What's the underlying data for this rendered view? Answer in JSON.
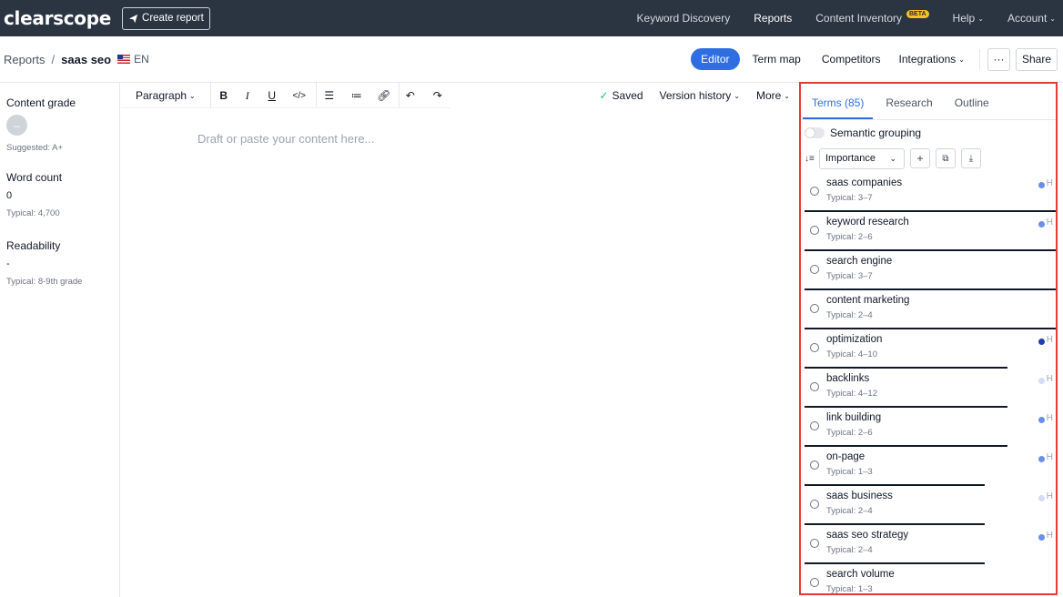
{
  "topnav": {
    "logo": "clearscope",
    "create_report": "Create report",
    "items": [
      {
        "label": "Keyword Discovery"
      },
      {
        "label": "Reports"
      },
      {
        "label": "Content Inventory",
        "badge": "BETA"
      },
      {
        "label": "Help"
      },
      {
        "label": "Account"
      }
    ]
  },
  "breadcrumb": {
    "root": "Reports",
    "separator": "/",
    "current": "saas seo",
    "lang": "EN"
  },
  "subnav": {
    "editor": "Editor",
    "term_map": "Term map",
    "competitors": "Competitors",
    "integrations": "Integrations",
    "more": "···",
    "share": "Share"
  },
  "stats": {
    "content_grade": {
      "label": "Content grade",
      "value": "–",
      "sub": "Suggested: A+"
    },
    "word_count": {
      "label": "Word count",
      "value": "0",
      "sub": "Typical: 4,700"
    },
    "readability": {
      "label": "Readability",
      "value": "-",
      "sub": "Typical: 8-9th grade"
    }
  },
  "toolbar": {
    "paragraph": "Paragraph",
    "saved": "Saved",
    "version_history": "Version history",
    "more": "More"
  },
  "editor": {
    "placeholder": "Draft or paste your content here..."
  },
  "panel": {
    "tabs": [
      "Terms (85)",
      "Research",
      "Outline"
    ],
    "semantic_grouping": "Semantic grouping",
    "sort_select": "Importance",
    "terms": [
      {
        "name": "saas companies",
        "typical": "Typical: 3–7",
        "h": "H",
        "dot_color": "#6b8fe8",
        "progress": 1.0
      },
      {
        "name": "keyword research",
        "typical": "Typical: 2–6",
        "h": "H",
        "dot_color": "#6b8fe8",
        "progress": 1.0
      },
      {
        "name": "search engine",
        "typical": "Typical: 3–7",
        "h": "",
        "dot_color": "",
        "progress": 1.0
      },
      {
        "name": "content marketing",
        "typical": "Typical: 2–4",
        "h": "",
        "dot_color": "",
        "progress": 1.0
      },
      {
        "name": "optimization",
        "typical": "Typical: 4–10",
        "h": "H",
        "dot_color": "#1e40af",
        "progress": 0.9
      },
      {
        "name": "backlinks",
        "typical": "Typical: 4–12",
        "h": "H",
        "dot_color": "#d5dcf5",
        "progress": 0.9
      },
      {
        "name": "link building",
        "typical": "Typical: 2–6",
        "h": "H",
        "dot_color": "#6b8fe8",
        "progress": 0.9
      },
      {
        "name": "on-page",
        "typical": "Typical: 1–3",
        "h": "H",
        "dot_color": "#6b8fe8",
        "progress": 0.8
      },
      {
        "name": "saas business",
        "typical": "Typical: 2–4",
        "h": "H",
        "dot_color": "#d5dcf5",
        "progress": 0.8
      },
      {
        "name": "saas seo strategy",
        "typical": "Typical: 2–4",
        "h": "H",
        "dot_color": "#6b8fe8",
        "progress": 0.8
      },
      {
        "name": "search volume",
        "typical": "Typical: 1–3",
        "h": "",
        "dot_color": "",
        "progress": 0
      }
    ]
  }
}
